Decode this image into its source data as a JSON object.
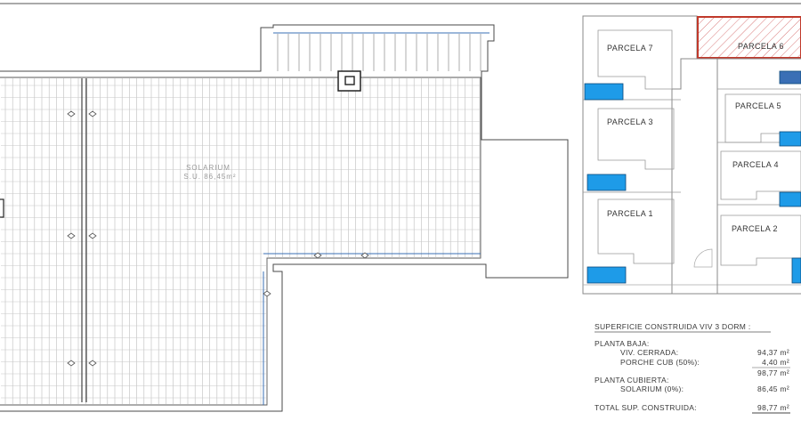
{
  "solarium": {
    "name": "SOLARIUM",
    "area": "S.U. 86,45m²"
  },
  "parcels": [
    {
      "label": "PARCELA 7"
    },
    {
      "label": "PARCELA 6"
    },
    {
      "label": "PARCELA 5"
    },
    {
      "label": "PARCELA 3"
    },
    {
      "label": "PARCELA 4"
    },
    {
      "label": "PARCELA 1"
    },
    {
      "label": "PARCELA 2"
    }
  ],
  "summary": {
    "title": "SUPERFICIE CONSTRUIDA VIV 3 DORM :",
    "planta_baja": "PLANTA BAJA:",
    "viv_cerrada_label": "VIV. CERRADA:",
    "viv_cerrada_value": "94,37 m²",
    "porche_label": "PORCHE CUB (50%):",
    "porche_value": "4,40 m²",
    "subtotal_value": "98,77 m²",
    "planta_cubierta": "PLANTA CUBIERTA:",
    "solarium_label": "SOLARIUM (0%):",
    "solarium_value": "86,45 m²",
    "total_label": "TOTAL SUP. CONSTRUIDA:",
    "total_value": "98,77 m²"
  },
  "colors": {
    "line": "#4a4a4a",
    "pool": "#1e9be8",
    "highlight": "#c0392b",
    "accent_blue": "#3a6fb5"
  }
}
